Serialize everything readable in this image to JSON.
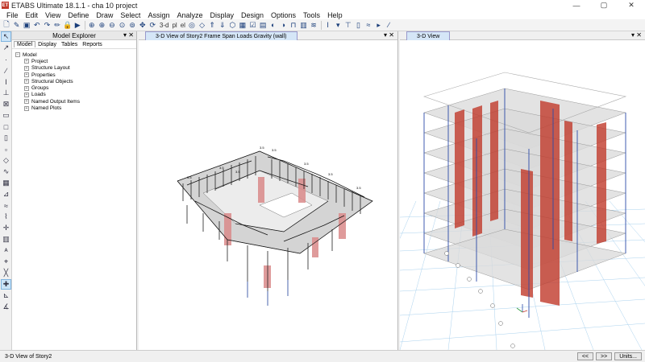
{
  "window": {
    "title": "ETABS Ultimate 18.1.1 - cha 10 project",
    "logo": "ET",
    "controls": [
      "—",
      "▢",
      "✕"
    ]
  },
  "menu": [
    "File",
    "Edit",
    "View",
    "Define",
    "Draw",
    "Select",
    "Assign",
    "Analyze",
    "Display",
    "Design",
    "Options",
    "Tools",
    "Help"
  ],
  "toolbar": {
    "view_3d_label": "3-d",
    "plan_label": "pl",
    "elev_label": "el"
  },
  "explorer": {
    "title": "Model Explorer",
    "tabs": [
      "Model",
      "Display",
      "Tables",
      "Reports"
    ],
    "active_tab": "Model",
    "root": "Model",
    "items": [
      "Project",
      "Structure Layout",
      "Properties",
      "Structural Objects",
      "Groups",
      "Loads",
      "Named Output Items",
      "Named Plots"
    ]
  },
  "view1": {
    "tab_label": "3-D View of Story2  Frame Span Loads Gravity (wall)"
  },
  "view2": {
    "tab_label": "3-D View"
  },
  "status": {
    "text": "3-D View of Story2",
    "prev_label": "<<",
    "next_label": ">>",
    "units_label": "Units..."
  },
  "colors": {
    "wall": "#c0392b",
    "slab": "#cfcfcf",
    "column": "#2b4aa8",
    "grid": "#9ec9e8"
  }
}
